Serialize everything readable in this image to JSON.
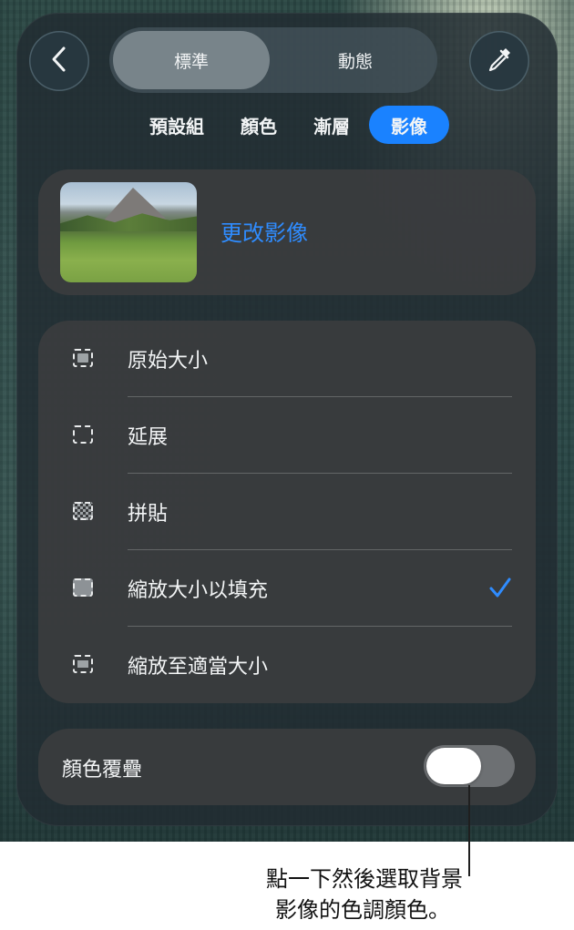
{
  "header": {
    "segments": [
      "標準",
      "動態"
    ],
    "active_segment": "標準"
  },
  "tabs": [
    {
      "label": "預設組",
      "active": false
    },
    {
      "label": "顏色",
      "active": false
    },
    {
      "label": "漸層",
      "active": false
    },
    {
      "label": "影像",
      "active": true
    }
  ],
  "image_card": {
    "change_label": "更改影像"
  },
  "options": [
    {
      "label": "原始大小",
      "icon": "original-size-icon",
      "selected": false
    },
    {
      "label": "延展",
      "icon": "stretch-icon",
      "selected": false
    },
    {
      "label": "拼貼",
      "icon": "tile-icon",
      "selected": false
    },
    {
      "label": "縮放大小以填充",
      "icon": "scale-to-fill-icon",
      "selected": true
    },
    {
      "label": "縮放至適當大小",
      "icon": "scale-to-fit-icon",
      "selected": false
    }
  ],
  "overlay": {
    "label": "顏色覆疊",
    "toggle_on": false
  },
  "callout": {
    "line1": "點一下然後選取背景",
    "line2": "影像的色調顏色。"
  },
  "colors": {
    "accent": "#1a82ff",
    "link": "#2f8cff",
    "checkmark": "#2f8cff"
  }
}
